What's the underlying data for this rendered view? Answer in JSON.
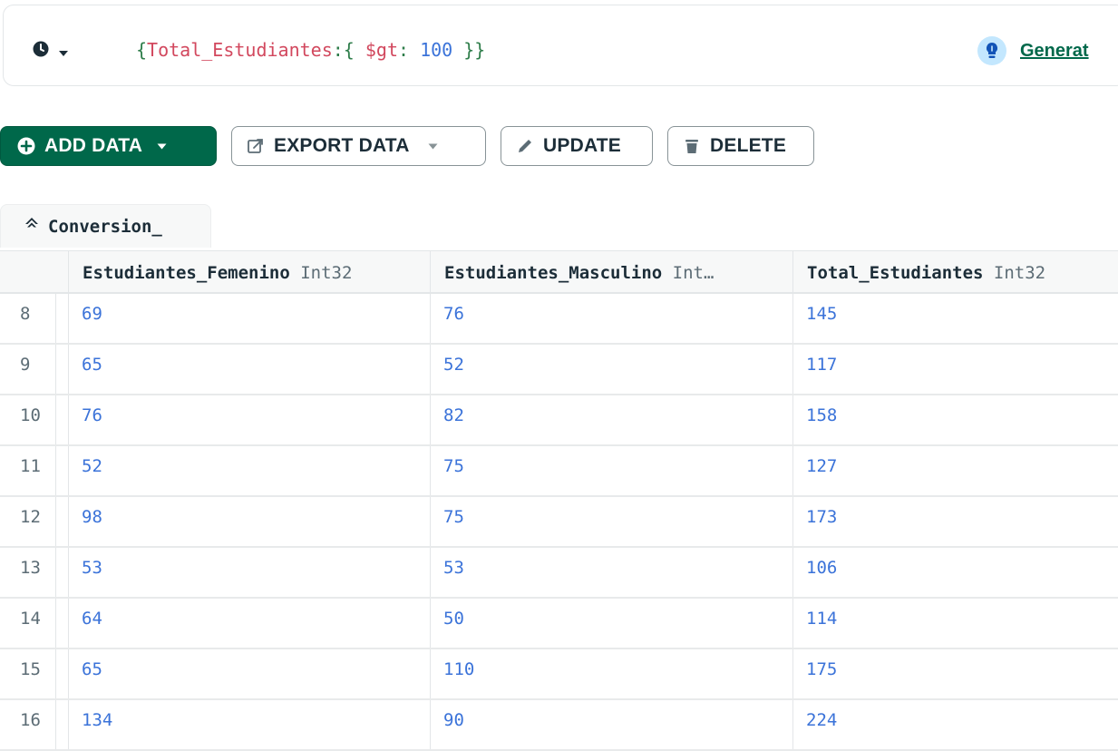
{
  "query": {
    "history_icon": "clock-icon",
    "filter": {
      "open": "{",
      "field": "Total_Estudiantes",
      "colon": ":{ ",
      "operator": "$gt",
      "op_colon": ": ",
      "value": "100",
      "close": " }}"
    },
    "assistant_icon": "lightbulb-icon",
    "generate_label": "Generat"
  },
  "toolbar": {
    "add_data": "ADD DATA",
    "export_data": "EXPORT DATA",
    "update": "UPDATE",
    "delete": "DELETE"
  },
  "collection_tab": {
    "icon": "home-icon",
    "label": "Conversion_"
  },
  "table": {
    "columns": [
      {
        "name": "Estudiantes_Femenino",
        "type": "Int32"
      },
      {
        "name": "Estudiantes_Masculino",
        "type": "Int…"
      },
      {
        "name": "Total_Estudiantes",
        "type": "Int32"
      }
    ],
    "rows": [
      {
        "index": "8",
        "values": [
          "69",
          "76",
          "145"
        ]
      },
      {
        "index": "9",
        "values": [
          "65",
          "52",
          "117"
        ]
      },
      {
        "index": "10",
        "values": [
          "76",
          "82",
          "158"
        ]
      },
      {
        "index": "11",
        "values": [
          "52",
          "75",
          "127"
        ]
      },
      {
        "index": "12",
        "values": [
          "98",
          "75",
          "173"
        ]
      },
      {
        "index": "13",
        "values": [
          "53",
          "53",
          "106"
        ]
      },
      {
        "index": "14",
        "values": [
          "64",
          "50",
          "114"
        ]
      },
      {
        "index": "15",
        "values": [
          "65",
          "110",
          "175"
        ]
      },
      {
        "index": "16",
        "values": [
          "134",
          "90",
          "224"
        ]
      }
    ]
  },
  "colors": {
    "primary": "#00684a",
    "value_blue": "#3b73d9",
    "field_red": "#d2485e"
  }
}
